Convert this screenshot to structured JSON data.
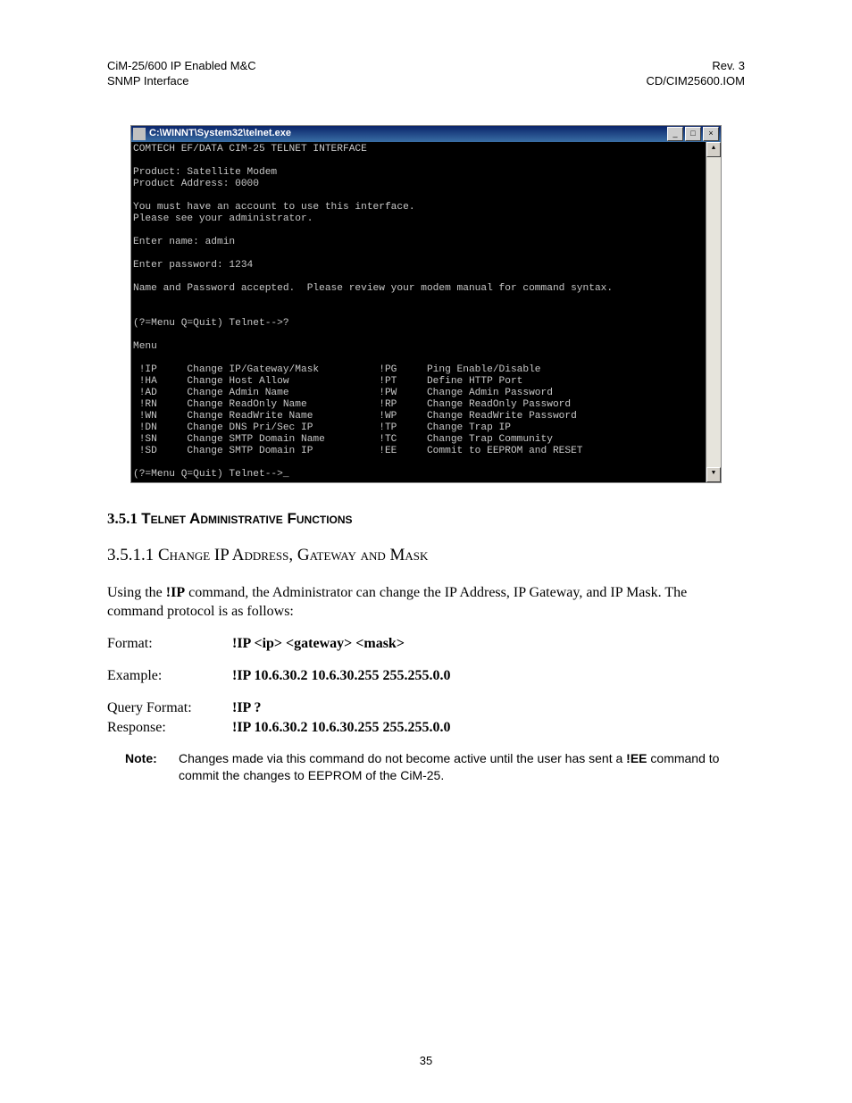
{
  "header": {
    "left_line1": "CiM-25/600 IP Enabled M&C",
    "left_line2": "SNMP Interface",
    "right_line1": "Rev. 3",
    "right_line2": "CD/CIM25600.IOM"
  },
  "telnet": {
    "title": "C:\\WINNT\\System32\\telnet.exe",
    "btn_min": "_",
    "btn_max": "□",
    "btn_close": "×",
    "scroll_up": "▲",
    "scroll_down": "▼",
    "lines": {
      "l0": "COMTECH EF/DATA CIM-25 TELNET INTERFACE",
      "l1": "",
      "l2": "Product: Satellite Modem",
      "l3": "Product Address: 0000",
      "l4": "",
      "l5": "You must have an account to use this interface.",
      "l6": "Please see your administrator.",
      "l7": "",
      "l8": "Enter name: admin",
      "l9": "",
      "l10": "Enter password: 1234",
      "l11": "",
      "l12": "Name and Password accepted.  Please review your modem manual for command syntax.",
      "l13": "",
      "l14": "",
      "l15": "(?=Menu Q=Quit) Telnet-->?",
      "l16": "",
      "l17": "Menu",
      "l18": "",
      "l19": " !IP     Change IP/Gateway/Mask          !PG     Ping Enable/Disable",
      "l20": " !HA     Change Host Allow               !PT     Define HTTP Port",
      "l21": " !AD     Change Admin Name               !PW     Change Admin Password",
      "l22": " !RN     Change ReadOnly Name            !RP     Change ReadOnly Password",
      "l23": " !WN     Change ReadWrite Name           !WP     Change ReadWrite Password",
      "l24": " !DN     Change DNS Pri/Sec IP           !TP     Change Trap IP",
      "l25": " !SN     Change SMTP Domain Name         !TC     Change Trap Community",
      "l26": " !SD     Change SMTP Domain IP           !EE     Commit to EEPROM and RESET",
      "l27": "",
      "l28": "(?=Menu Q=Quit) Telnet-->_"
    }
  },
  "sections": {
    "s351_num": "3.5.1 ",
    "s351_title": "Telnet Administrative Functions",
    "s3511_num": "3.5.1.1   ",
    "s3511_title": "Change IP Address, Gateway and Mask"
  },
  "body": {
    "para1a": "Using the ",
    "para1b": "!IP",
    "para1c": " command, the Administrator can change the IP Address, IP Gateway, and IP Mask. The command protocol is as follows:"
  },
  "def": {
    "format_label": "Format:",
    "format_value": "!IP <ip> <gateway> <mask>",
    "example_label": "Example:",
    "example_value": "!IP 10.6.30.2 10.6.30.255 255.255.0.0",
    "query_label": "Query Format:",
    "query_value": "!IP ?",
    "resp_label": "Response:",
    "resp_value": "!IP 10.6.30.2 10.6.30.255 255.255.0.0"
  },
  "note": {
    "label": "Note:",
    "text_a": "Changes made via this command do not become active until the user has sent a ",
    "text_b": "!EE",
    "text_c": " command to commit the changes to EEPROM of the CiM-25."
  },
  "page_number": "35"
}
